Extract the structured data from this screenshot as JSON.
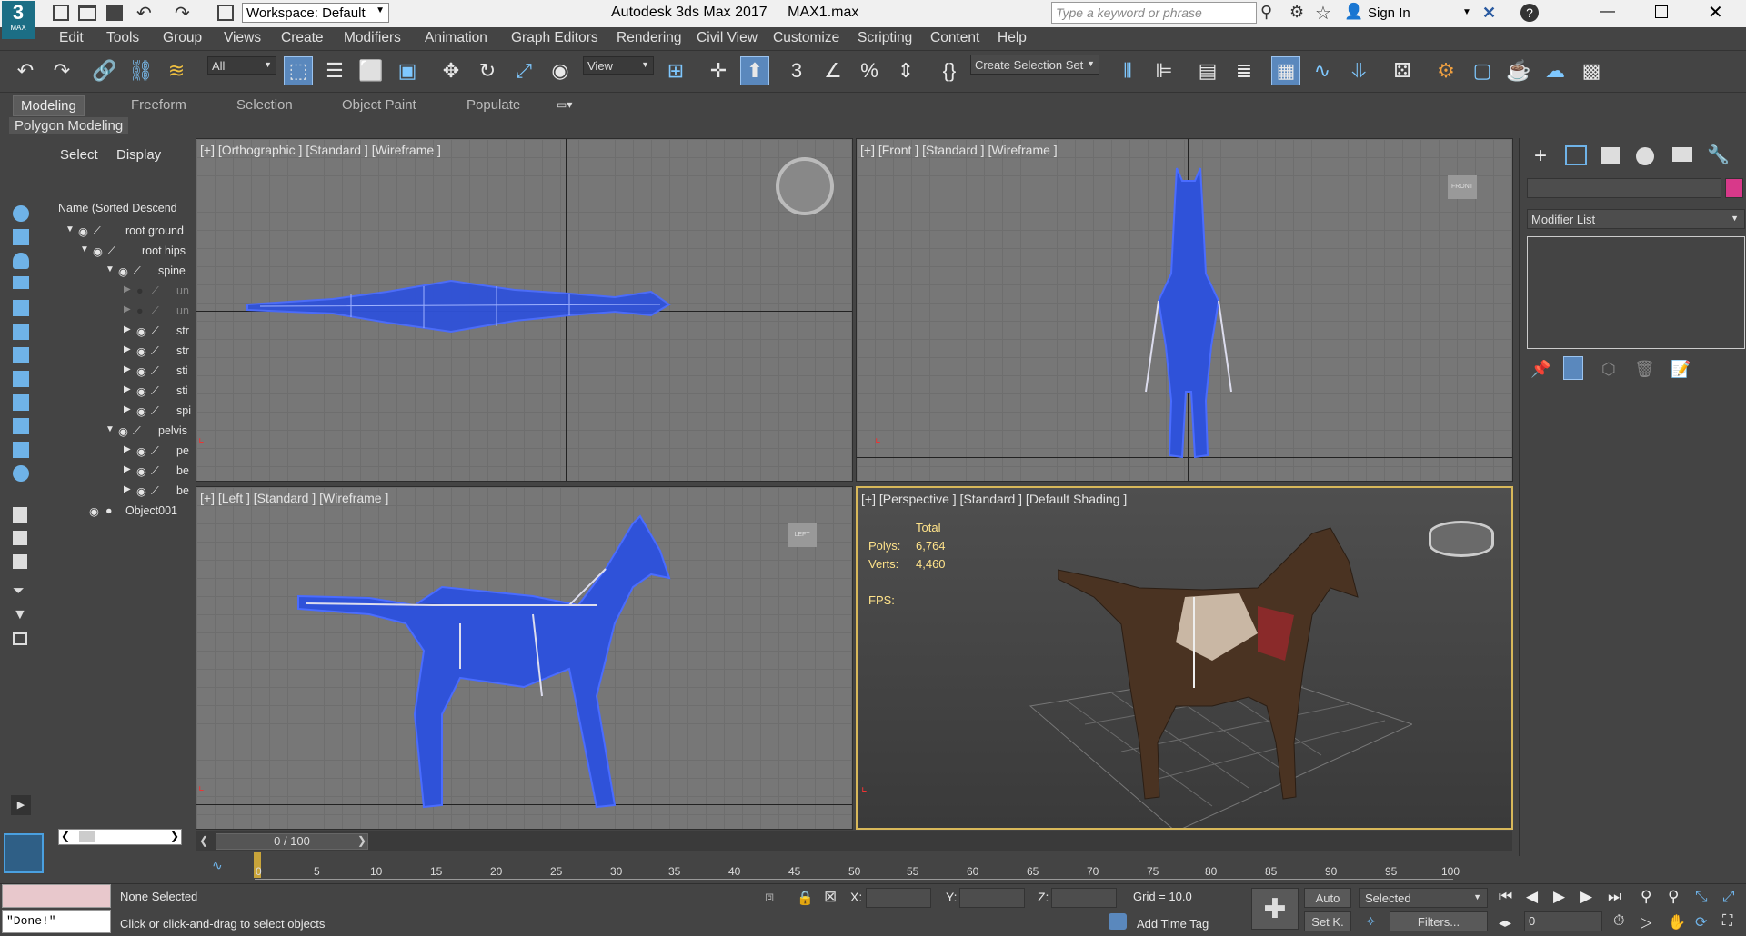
{
  "titlebar": {
    "app_title": "Autodesk 3ds Max 2017",
    "file_name": "MAX1.max",
    "workspace": "Workspace: Default",
    "search_placeholder": "Type a keyword or phrase",
    "sign_in": "Sign In",
    "logo_text": "MAX"
  },
  "menu": [
    "Edit",
    "Tools",
    "Group",
    "Views",
    "Create",
    "Modifiers",
    "Animation",
    "Graph Editors",
    "Rendering",
    "Civil View",
    "Customize",
    "Scripting",
    "Content",
    "Help"
  ],
  "toolbar": {
    "filter_value": "All",
    "refcoord_value": "View",
    "selection_set": "Create Selection Set"
  },
  "ribbon": {
    "tabs": [
      "Modeling",
      "Freeform",
      "Selection",
      "Object Paint",
      "Populate"
    ],
    "subtitle": "Polygon Modeling"
  },
  "explorer": {
    "tabs": [
      "Select",
      "Display"
    ],
    "column_header": "Name (Sorted Descend",
    "rows": [
      {
        "label": "root ground"
      },
      {
        "label": "root hips"
      },
      {
        "label": "spine"
      },
      {
        "label": "un"
      },
      {
        "label": "un"
      },
      {
        "label": "str"
      },
      {
        "label": "str"
      },
      {
        "label": "sti"
      },
      {
        "label": "sti"
      },
      {
        "label": "spi"
      },
      {
        "label": "pelvis"
      },
      {
        "label": "pe"
      },
      {
        "label": "be"
      },
      {
        "label": "be"
      },
      {
        "label": "Object001"
      }
    ]
  },
  "viewports": {
    "top_left": "[+] [Orthographic ] [Standard ] [Wireframe ]",
    "top_right": "[+] [Front ] [Standard ] [Wireframe ]",
    "bottom_left": "[+] [Left ] [Standard ] [Wireframe ]",
    "bottom_right": "[+] [Perspective ] [Standard ] [Default Shading ]",
    "stats": {
      "total": "Total",
      "polys_label": "Polys:",
      "polys": "6,764",
      "verts_label": "Verts:",
      "verts": "4,460",
      "fps_label": "FPS:"
    },
    "viewcube_front": "FRONT",
    "viewcube_left": "LEFT"
  },
  "command_panel": {
    "modifier_list": "Modifier List",
    "object_color": "#d8398a"
  },
  "timeline": {
    "frame_counter": "0 / 100",
    "ticks": [
      "0",
      "5",
      "10",
      "15",
      "20",
      "25",
      "30",
      "35",
      "40",
      "45",
      "50",
      "55",
      "60",
      "65",
      "70",
      "75",
      "80",
      "85",
      "90",
      "95",
      "100"
    ]
  },
  "status": {
    "maxscript_output": "\"Done!\"",
    "selection": "None Selected",
    "prompt": "Click or click-and-drag to select objects",
    "x_label": "X:",
    "y_label": "Y:",
    "z_label": "Z:",
    "grid": "Grid = 10.0",
    "add_time_tag": "Add Time Tag",
    "auto_key": "Auto",
    "set_key": "Set K.",
    "key_mode": "Selected",
    "filters": "Filters...",
    "current_frame": "0"
  }
}
